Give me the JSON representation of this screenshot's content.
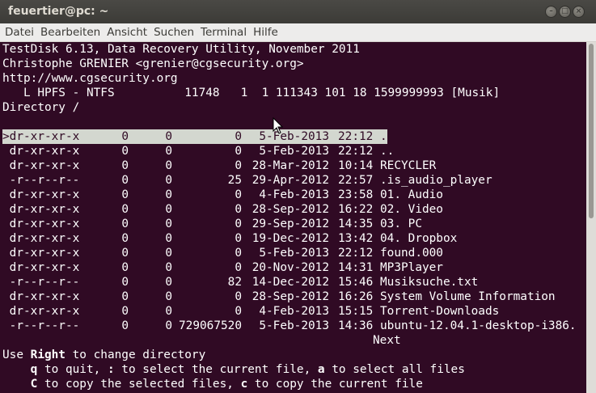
{
  "window": {
    "title": "feuertier@pc: ~",
    "minimize_glyph": "–",
    "maximize_glyph": "□",
    "close_glyph": "×"
  },
  "menu": [
    "Datei",
    "Bearbeiten",
    "Ansicht",
    "Suchen",
    "Terminal",
    "Hilfe"
  ],
  "header": {
    "line1": "TestDisk 6.13, Data Recovery Utility, November 2011",
    "line2": "Christophe GRENIER <grenier@cgsecurity.org>",
    "line3": "http://www.cgsecurity.org",
    "line4": "   L HPFS - NTFS          11748   1  1 111343 101 18 1599999993 [Musik]",
    "line5": "Directory /"
  },
  "files": [
    {
      "perm": ">dr-xr-xr-x",
      "uid": "0",
      "gid": "0",
      "size": "0",
      "date": "5-Feb-2013",
      "time": "22:12",
      "name": ".",
      "selected": true
    },
    {
      "perm": " dr-xr-xr-x",
      "uid": "0",
      "gid": "0",
      "size": "0",
      "date": "5-Feb-2013",
      "time": "22:12",
      "name": ".."
    },
    {
      "perm": " dr-xr-xr-x",
      "uid": "0",
      "gid": "0",
      "size": "0",
      "date": "28-Mar-2012",
      "time": "10:14",
      "name": "RECYCLER"
    },
    {
      "perm": " -r--r--r--",
      "uid": "0",
      "gid": "0",
      "size": "25",
      "date": "29-Apr-2012",
      "time": "22:57",
      "name": ".is_audio_player"
    },
    {
      "perm": " dr-xr-xr-x",
      "uid": "0",
      "gid": "0",
      "size": "0",
      "date": "4-Feb-2013",
      "time": "23:58",
      "name": "01. Audio"
    },
    {
      "perm": " dr-xr-xr-x",
      "uid": "0",
      "gid": "0",
      "size": "0",
      "date": "28-Sep-2012",
      "time": "16:22",
      "name": "02. Video"
    },
    {
      "perm": " dr-xr-xr-x",
      "uid": "0",
      "gid": "0",
      "size": "0",
      "date": "29-Sep-2012",
      "time": "14:35",
      "name": "03. PC"
    },
    {
      "perm": " dr-xr-xr-x",
      "uid": "0",
      "gid": "0",
      "size": "0",
      "date": "19-Dec-2012",
      "time": "13:42",
      "name": "04. Dropbox"
    },
    {
      "perm": " dr-xr-xr-x",
      "uid": "0",
      "gid": "0",
      "size": "0",
      "date": "5-Feb-2013",
      "time": "22:12",
      "name": "found.000"
    },
    {
      "perm": " dr-xr-xr-x",
      "uid": "0",
      "gid": "0",
      "size": "0",
      "date": "20-Nov-2012",
      "time": "14:31",
      "name": "MP3Player"
    },
    {
      "perm": " -r--r--r--",
      "uid": "0",
      "gid": "0",
      "size": "82",
      "date": "14-Dec-2012",
      "time": "15:46",
      "name": "Musiksuche.txt"
    },
    {
      "perm": " dr-xr-xr-x",
      "uid": "0",
      "gid": "0",
      "size": "0",
      "date": "28-Sep-2012",
      "time": "16:26",
      "name": "System Volume Information"
    },
    {
      "perm": " dr-xr-xr-x",
      "uid": "0",
      "gid": "0",
      "size": "0",
      "date": "4-Feb-2013",
      "time": "15:15",
      "name": "Torrent-Downloads"
    },
    {
      "perm": " -r--r--r--",
      "uid": "0",
      "gid": "0",
      "size": "729067520",
      "date": "5-Feb-2013",
      "time": "14:36",
      "name": "ubuntu-12.04.1-desktop-i386."
    }
  ],
  "next_label": "Next",
  "help": {
    "l1_pre": "Use ",
    "l1_key": "Right",
    "l1_post": " to change directory",
    "l2_indent": "    ",
    "l2_k1": "q",
    "l2_t1": " to quit, ",
    "l2_k2": ":",
    "l2_t2": " to select the current file, ",
    "l2_k3": "a",
    "l2_t3": " to select all files",
    "l3_indent": "    ",
    "l3_k1": "C",
    "l3_t1": " to copy the selected files, ",
    "l3_k2": "c",
    "l3_t2": " to copy the current file"
  },
  "colors": {
    "terminal_bg": "#300a24",
    "terminal_fg": "#ffffff",
    "selection_bg": "#d3d7cf",
    "titlebar_bg": "#3c3b37",
    "menubar_bg": "#edeceb"
  }
}
